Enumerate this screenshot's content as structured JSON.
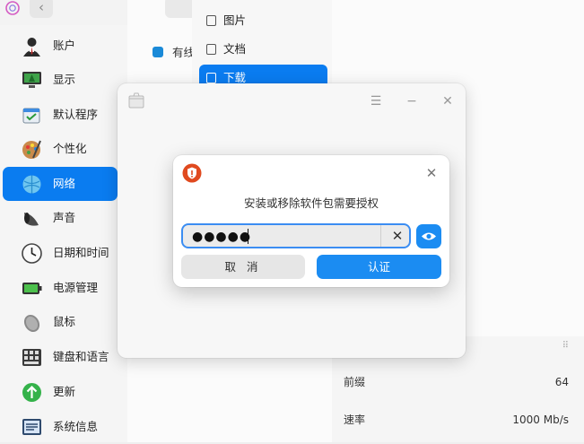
{
  "sidebar": {
    "items": [
      {
        "label": "账户",
        "icon": "account-icon"
      },
      {
        "label": "显示",
        "icon": "display-icon"
      },
      {
        "label": "默认程序",
        "icon": "default-apps-icon"
      },
      {
        "label": "个性化",
        "icon": "personalization-icon"
      },
      {
        "label": "网络",
        "icon": "network-icon",
        "active": true
      },
      {
        "label": "声音",
        "icon": "sound-icon"
      },
      {
        "label": "日期和时间",
        "icon": "clock-icon"
      },
      {
        "label": "电源管理",
        "icon": "battery-icon"
      },
      {
        "label": "鼠标",
        "icon": "mouse-icon"
      },
      {
        "label": "键盘和语言",
        "icon": "keyboard-icon"
      },
      {
        "label": "更新",
        "icon": "update-icon"
      },
      {
        "label": "系统信息",
        "icon": "system-info-icon"
      }
    ]
  },
  "middle": {
    "row_label": "有线"
  },
  "file_picker": {
    "items": [
      {
        "label": "图片",
        "icon": "picture-icon"
      },
      {
        "label": "文档",
        "icon": "document-icon"
      },
      {
        "label": "下载",
        "icon": "download-icon",
        "active": true
      }
    ]
  },
  "right_panel": {
    "rows": [
      {
        "key": "前缀",
        "value": "64"
      },
      {
        "key": "速率",
        "value": "1000 Mb/s"
      }
    ]
  },
  "auth_dialog": {
    "title": "安装或移除软件包需要授权",
    "password_value": "●●●●●",
    "cancel_label": "取 消",
    "confirm_label": "认证"
  },
  "colors": {
    "accent": "#0a7cf0",
    "shield": "#e04a1f"
  }
}
